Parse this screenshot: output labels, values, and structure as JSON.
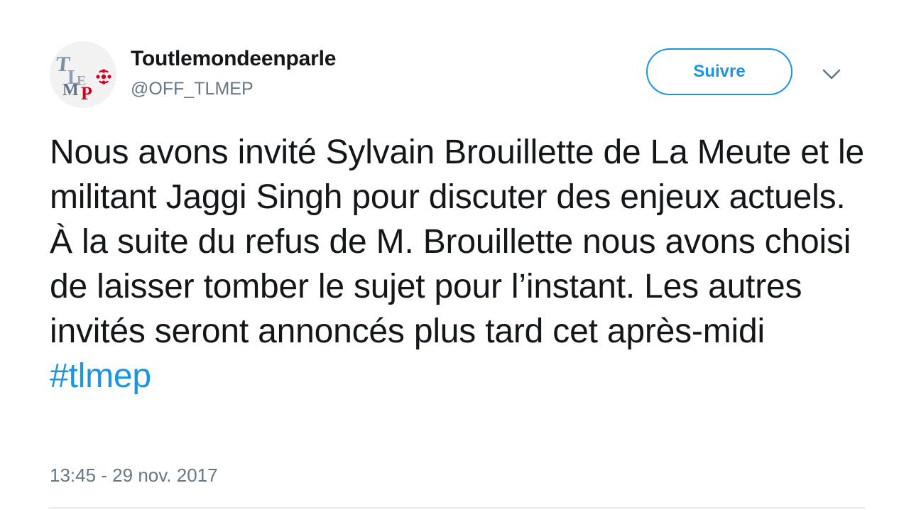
{
  "user": {
    "display_name": "Toutlemondeenparle",
    "handle": "@OFF_TLMEP",
    "avatar_icon": "tlmep-logo-icon",
    "avatar_text": "TLMEP"
  },
  "actions": {
    "follow_label": "Suivre",
    "more_icon": "chevron-down-icon"
  },
  "tweet": {
    "text": "Nous avons invité Sylvain Brouillette de La Meute et le militant Jaggi Singh pour discuter des enjeux actuels.  À la suite du refus de M. Brouillette nous avons choisi de laisser tomber le sujet pour l’instant. Les autres invités seront annoncés plus tard cet après-midi ",
    "hashtag": "#tlmep",
    "timestamp": "13:45 - 29 nov. 2017"
  },
  "colors": {
    "accent": "#1b95e0",
    "text": "#14171a",
    "secondary_text": "#657786",
    "divider": "#e6ecf0",
    "logo_red": "#d6001c"
  }
}
